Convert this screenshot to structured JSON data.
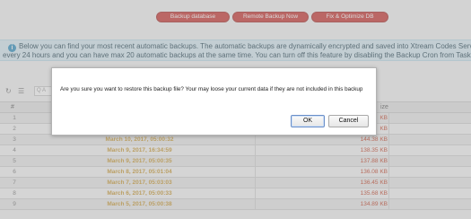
{
  "actions": {
    "backup_database": "Backup database",
    "remote_backup_now": "Remote Backup Now",
    "fix_optimize_db": "Fix & Optimize DB"
  },
  "info": {
    "line1": "Below you can find your most recent automatic backups. The automatic backups are dynamically encrypted and saved into Xtream Codes Servers. The",
    "line2": "every 24 hours and you can have max 20 automatic backups at the same time. You can turn off this feature by disabling the Backup Cron from Task Manager"
  },
  "toolbar": {
    "search_text": "Q A"
  },
  "table": {
    "headers": {
      "num": "#",
      "size": "ize"
    },
    "rows": [
      {
        "num": "1",
        "date": "",
        "size": "KB"
      },
      {
        "num": "2",
        "date": "",
        "size": "KB"
      },
      {
        "num": "3",
        "date": "March 10, 2017, 05:00:32",
        "size": "144.38 KB"
      },
      {
        "num": "4",
        "date": "March 9, 2017, 16:34:59",
        "size": "138.35 KB"
      },
      {
        "num": "5",
        "date": "March 9, 2017, 05:00:35",
        "size": "137.88 KB"
      },
      {
        "num": "6",
        "date": "March 8, 2017, 05:01:04",
        "size": "136.08 KB"
      },
      {
        "num": "7",
        "date": "March 7, 2017, 05:03:03",
        "size": "136.45 KB"
      },
      {
        "num": "8",
        "date": "March 6, 2017, 05:00:33",
        "size": "135.68 KB"
      },
      {
        "num": "9",
        "date": "March 5, 2017, 05:00:38",
        "size": "134.89 KB"
      }
    ]
  },
  "modal": {
    "message": "Are you sure you want to restore this backup file? Your may loose your current data if they are not included in this backup",
    "ok_label": "OK",
    "cancel_label": "Cancel"
  }
}
